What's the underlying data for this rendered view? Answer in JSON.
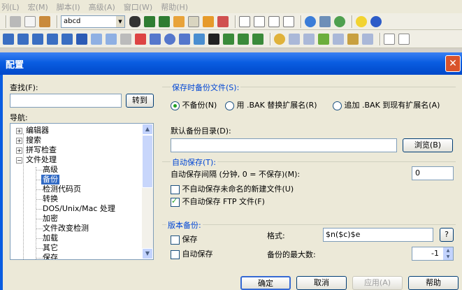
{
  "menu": [
    "列(L)",
    "宏(M)",
    "脚本(I)",
    "高级(A)",
    "窗口(W)",
    "帮助(H)"
  ],
  "toolbar": {
    "font_value": "abcd"
  },
  "dialog": {
    "title": "配置",
    "search_label": "查找(F):",
    "goto_button": "转到",
    "nav_label": "导航:",
    "tree": [
      {
        "label": "编辑器",
        "sign": "+"
      },
      {
        "label": "搜索",
        "sign": "+"
      },
      {
        "label": "拼写检查",
        "sign": "+"
      },
      {
        "label": "文件处理",
        "sign": "−"
      },
      {
        "label": "高级"
      },
      {
        "label": "备份",
        "selected": true
      },
      {
        "label": "检测代码页"
      },
      {
        "label": "转换"
      },
      {
        "label": "DOS/Unix/Mac 处理"
      },
      {
        "label": "加密"
      },
      {
        "label": "文件改变检测"
      },
      {
        "label": "加载"
      },
      {
        "label": "其它"
      },
      {
        "label": "保存"
      }
    ],
    "save_backup": {
      "header": "保存时备份文件(S):",
      "opt_none": "不备份(N)",
      "opt_bak": "用 .BAK 替换扩展名(R)",
      "opt_append": "追加 .BAK 到现有扩展名(A)"
    },
    "default_dir": {
      "label": "默认备份目录(D):",
      "value": "",
      "browse": "浏览(B)"
    },
    "autosave": {
      "header": "自动保存(T):",
      "interval_label": "自动保存间隔 (分钟, 0 = 不保存)(M):",
      "interval_value": "0",
      "no_unnamed": "不自动保存未命名的新建文件(U)",
      "no_ftp": "不自动保存 FTP 文件(F)"
    },
    "versions": {
      "header": "版本备份:",
      "save": "保存",
      "autosave": "自动保存",
      "format_label": "格式:",
      "format_value": "$n($c)$e",
      "help": "?",
      "max_label": "备份的最大数:",
      "max_value": "-1"
    },
    "buttons": {
      "ok": "确定",
      "cancel": "取消",
      "apply": "应用(A)",
      "help": "帮助"
    }
  },
  "colors": {
    "title_bar": "#0a5de1",
    "group_header": "#0046d5",
    "selection": "#316ac5"
  }
}
